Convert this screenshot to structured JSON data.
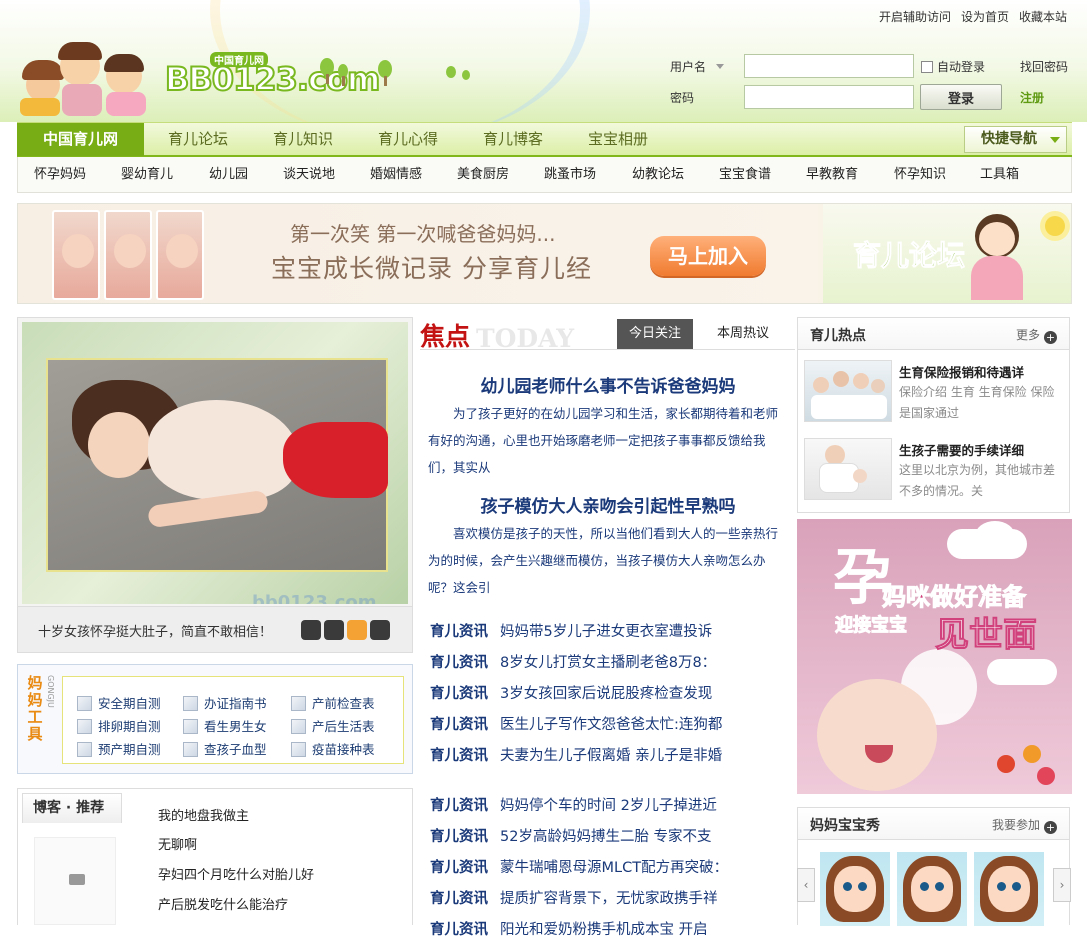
{
  "top_links": [
    "开启辅助访问",
    "设为首页",
    "收藏本站"
  ],
  "logo": {
    "text": "BB0123.com",
    "sub": "中国育儿网"
  },
  "login": {
    "username_label": "用户名",
    "password_label": "密码",
    "auto_login": "自动登录",
    "forgot": "找回密码",
    "login_button": "登录",
    "register": "注册"
  },
  "nav": {
    "items": [
      "中国育儿网",
      "育儿论坛",
      "育儿知识",
      "育儿心得",
      "育儿博客",
      "宝宝相册"
    ],
    "quick_nav": "快捷导航"
  },
  "subnav": [
    "怀孕妈妈",
    "婴幼育儿",
    "幼儿园",
    "谈天说地",
    "婚姻情感",
    "美食厨房",
    "跳蚤市场",
    "幼教论坛",
    "宝宝食谱",
    "早教教育",
    "怀孕知识",
    "工具箱"
  ],
  "ad_banner": {
    "line1": "第一次笑  第一次喊爸爸妈妈...",
    "line2": "宝宝成长微记录  分享育儿经",
    "join": "马上加入",
    "right_title": "育儿论坛"
  },
  "slideshow": {
    "caption": "十岁女孩怀孕挺大肚子，简直不敢相信！",
    "watermark": "bb0123.com"
  },
  "tools": {
    "label": "妈妈工具",
    "en": "GONGJU",
    "items": [
      "安全期自测",
      "办证指南书",
      "产前检查表",
      "排卵期自测",
      "看生男生女",
      "产后生活表",
      "预产期自测",
      "查孩子血型",
      "疫苗接种表"
    ]
  },
  "blog": {
    "title": "博客 · 推荐",
    "items": [
      "我的地盘我做主",
      "无聊啊",
      "孕妇四个月吃什么对胎儿好",
      "产后脱发吃什么能治疗"
    ]
  },
  "focus": {
    "title": "焦点",
    "en": "TODAY",
    "tabs": [
      "今日关注",
      "本周热议"
    ],
    "headlines": [
      {
        "title": "幼儿园老师什么事不告诉爸爸妈妈",
        "summary": "为了孩子更好的在幼儿园学习和生活，家长都期待着和老师有好的沟通，心里也开始琢磨老师一定把孩子事事都反馈给我们，其实从"
      },
      {
        "title": "孩子模仿大人亲吻会引起性早熟吗",
        "summary": "喜欢模仿是孩子的天性，所以当他们看到大人的一些亲热行为的时候，会产生兴趣继而模仿，当孩子模仿大人亲吻怎么办呢？这会引"
      }
    ],
    "news_tag": "育儿资讯",
    "news_group1": [
      "妈妈带5岁儿子进女更衣室遭投诉",
      "8岁女儿打赏女主播刷老爸8万8：",
      "3岁女孩回家后说屁股疼检查发现",
      "医生儿子写作文怨爸爸太忙:连狗都",
      "夫妻为生儿子假离婚 亲儿子是非婚"
    ],
    "news_group2": [
      "妈妈停个车的时间 2岁儿子掉进近",
      "52岁高龄妈妈搏生二胎 专家不支",
      "蒙牛瑞哺恩母源MLCT配方再突破：",
      "提质扩容背景下，无忧家政携手祥",
      "阳光和爱奶粉携手机成本宝 开启"
    ]
  },
  "hot": {
    "title": "育儿热点",
    "more": "更多",
    "items": [
      {
        "title": "生育保险报销和待遇详",
        "desc": "保险介绍    生育 生育保险 保险是国家通过"
      },
      {
        "title": "生孩子需要的手续详细",
        "desc": "这里以北京为例，其他城市差不多的情况。关"
      }
    ]
  },
  "preg_ad": {
    "big": "孕",
    "line1": "妈咪做好准备",
    "line2": "迎接宝宝",
    "line3": "见世面"
  },
  "show": {
    "title": "妈妈宝宝秀",
    "join": "我要参加"
  }
}
